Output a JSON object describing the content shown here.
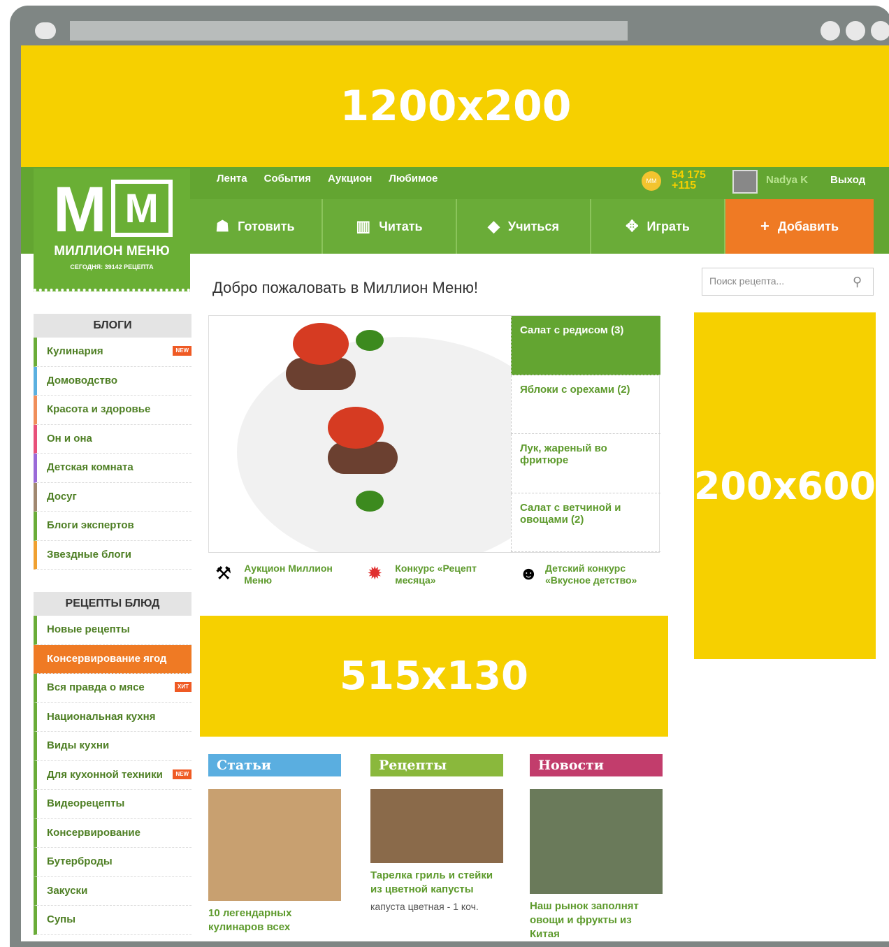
{
  "placeholders": {
    "top": "1200x200",
    "right": "200x600",
    "middle": "515x130"
  },
  "header": {
    "top_nav": [
      "Лента",
      "События",
      "Аукцион",
      "Любимое"
    ],
    "coins_total": "54 175",
    "coins_delta": "+115",
    "coin_label": "MM",
    "username": "Nadya K",
    "logout": "Выход"
  },
  "main_nav": [
    {
      "label": "Готовить",
      "icon": "chef-hat-icon"
    },
    {
      "label": "Читать",
      "icon": "books-icon"
    },
    {
      "label": "Учиться",
      "icon": "graduation-cap-icon"
    },
    {
      "label": "Играть",
      "icon": "gamepad-icon"
    },
    {
      "label": "Добавить",
      "icon": "plus-icon"
    }
  ],
  "logo": {
    "title": "МИЛЛИОН МЕНЮ",
    "subtitle": "СЕГОДНЯ: 39142 РЕЦЕПТА",
    "m1": "M",
    "m2": "M"
  },
  "welcome": "Добро пожаловать в Миллион Меню!",
  "search": {
    "placeholder": "Поиск рецепта..."
  },
  "blogs": {
    "header": "БЛОГИ",
    "items": [
      "Кулинария",
      "Домоводство",
      "Красота и здоровье",
      "Он и она",
      "Детская комната",
      "Досуг",
      "Блоги экспертов",
      "Звездные блоги"
    ],
    "new_badge": "NEW"
  },
  "recipes": {
    "header": "РЕЦЕПТЫ БЛЮД",
    "items": [
      "Новые рецепты",
      "Консервирование ягод",
      "Вся правда о мясе",
      "Национальная кухня",
      "Виды кухни",
      "Для кухонной техники",
      "Видеорецепты",
      "Консервирование",
      "Бутерброды",
      "Закуски",
      "Супы"
    ],
    "hit_badge": "ХИТ",
    "new_badge": "NEW"
  },
  "slider": {
    "items": [
      "Салат с редисом (3)",
      "Яблоки с орехами (2)",
      "Лук, жареный во фритюре",
      "Салат с ветчиной и овощами (2)"
    ]
  },
  "promos": [
    {
      "text": "Аукцион Миллион Меню",
      "icon": "gavel-icon"
    },
    {
      "text": "Конкурс «Рецепт месяца»",
      "icon": "medal-icon"
    },
    {
      "text": "Детский конкурс «Вкусное детство»",
      "icon": "smiley-icon"
    }
  ],
  "columns": [
    {
      "tag": "Статьи",
      "color": "#5aaee0",
      "title": "10 легендарных кулинаров всех",
      "sub": ""
    },
    {
      "tag": "Рецепты",
      "color": "#8ab83c",
      "title": "Тарелка гриль и стейки из цветной капусты",
      "sub": "капуста цветная - 1 коч."
    },
    {
      "tag": "Новости",
      "color": "#c23d6c",
      "title": "Наш рынок заполнят овощи и фрукты из Китая",
      "sub": ""
    }
  ]
}
